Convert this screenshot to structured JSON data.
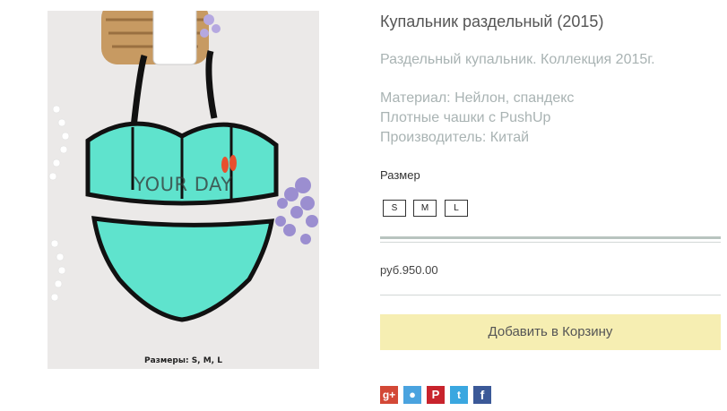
{
  "product": {
    "title": "Купальник раздельный (2015)",
    "desc_line1": "Раздельный купальник. Коллекция 2015г.",
    "desc_line2": "Материал: Нейлон, спандекс",
    "desc_line3": "Плотные чашки с PushUp",
    "desc_line4": "Производитель: Китай",
    "price": "руб.950.00"
  },
  "image": {
    "watermark": "YOUR DAY",
    "caption": "Размеры: S, M, L"
  },
  "size": {
    "label": "Размер",
    "options": [
      "S",
      "M",
      "L"
    ]
  },
  "cart": {
    "button_label": "Добавить в Корзину"
  },
  "share": {
    "icons": [
      "google-plus-icon",
      "odnoklassniki-icon",
      "pinterest-icon",
      "twitter-icon",
      "facebook-icon"
    ],
    "colors": [
      "#d34836",
      "#4aa3df",
      "#c8232c",
      "#3aa7e0",
      "#3b5998"
    ]
  },
  "colors": {
    "cart_bg": "#f6eeb2",
    "swimsuit": "#5fe3cd",
    "title_text": "#555555",
    "desc_text": "#a9b3b3"
  }
}
